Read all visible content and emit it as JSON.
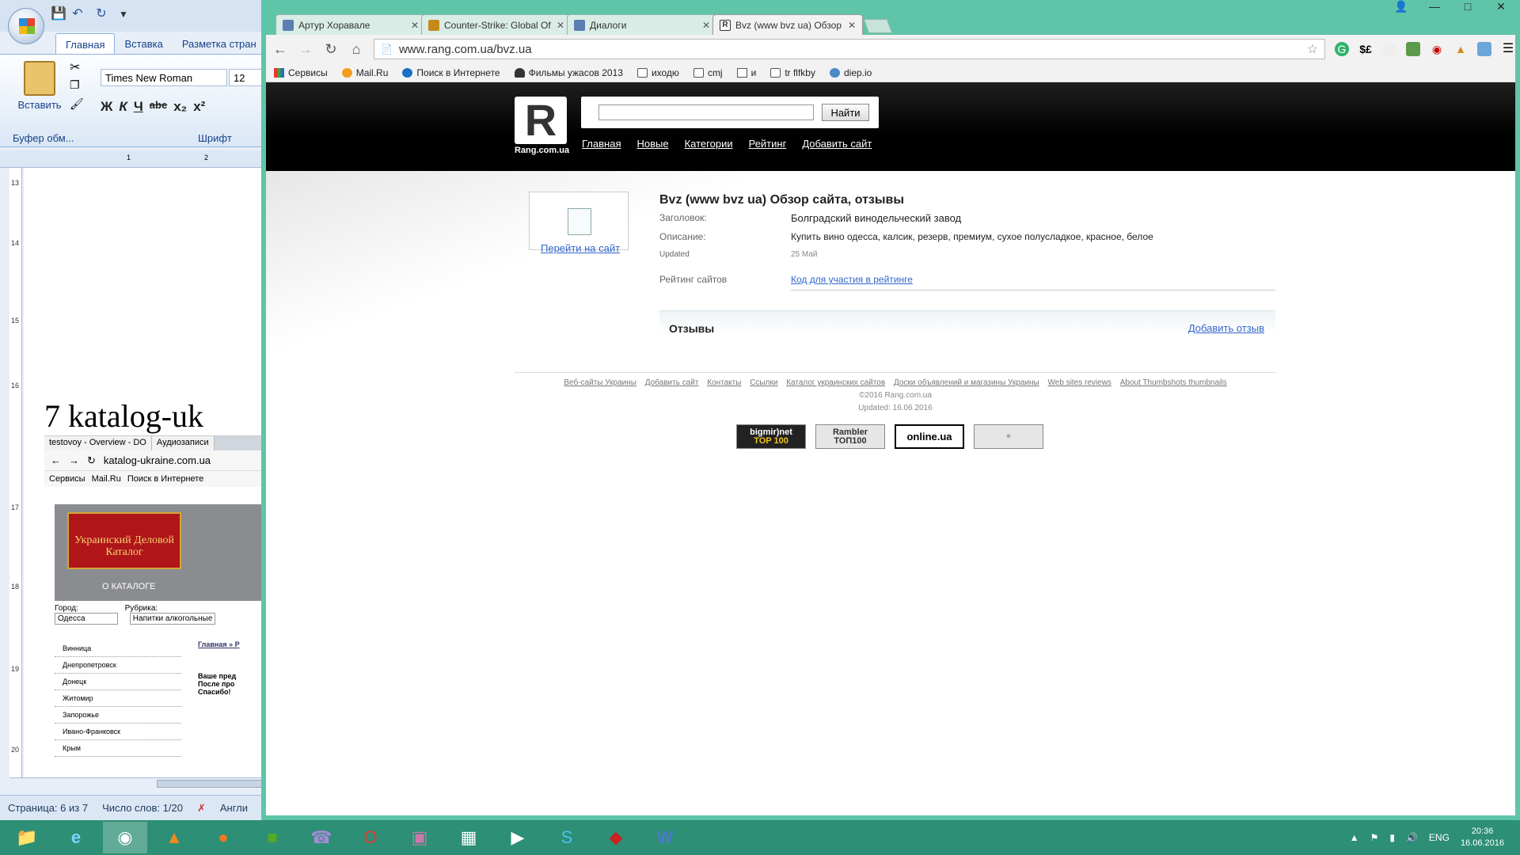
{
  "word": {
    "tabs": [
      "Главная",
      "Вставка",
      "Разметка стран"
    ],
    "paste_label": "Вставить",
    "font_name": "Times New Roman",
    "font_size": "12",
    "format_buttons": [
      "Ж",
      "К",
      "Ч",
      "abe",
      "x₂",
      "x²"
    ],
    "group_clipboard": "Буфер обм...",
    "group_font": "Шрифт",
    "ruler_numbers": [
      "1",
      "2"
    ],
    "vruler_numbers": [
      "13",
      "14",
      "15",
      "16",
      "17",
      "18",
      "19",
      "20"
    ],
    "doc_line": "7        katalog-uk",
    "embed": {
      "tabs": [
        "testovoy - Overview - DO",
        "Аудиозаписи"
      ],
      "address": "katalog-ukraine.com.ua",
      "bookmarks": [
        "Сервисы",
        "Mail.Ru",
        "Поиск в Интернете"
      ],
      "logo_text": "Украинский Деловой Каталог",
      "about": "О КАТАЛОГЕ",
      "city_label": "Город:",
      "city_value": "Одесса",
      "rubric_label": "Рубрика:",
      "rubric_value": "Напитки алкогольные",
      "breadcrumb": "Главная » Р",
      "cities": [
        "Винница",
        "Днепропетровск",
        "Донецк",
        "Житомир",
        "Запорожье",
        "Ивано-Франковск",
        "Крым"
      ],
      "notice": [
        "Ваше пред",
        "После про",
        "Спасибо!"
      ]
    },
    "status": {
      "page": "Страница: 6 из 7",
      "words": "Число слов: 1/20",
      "lang": "Англи"
    }
  },
  "chrome": {
    "tabs": [
      {
        "title": "Артур Хоравале",
        "color": "#5a7fb0"
      },
      {
        "title": "Counter-Strike: Global Of",
        "color": "#c68a1c"
      },
      {
        "title": "Диалоги",
        "color": "#5a7fb0"
      },
      {
        "title": "Bvz (www bvz ua) Обзор",
        "color": "#333333"
      }
    ],
    "url": "www.rang.com.ua/bvz.ua",
    "bookmarks": [
      "Сервисы",
      "Mail.Ru",
      "Поиск в Интернете",
      "Фильмы ужасов 2013",
      "иходю",
      "cmj",
      "и",
      "tr flfkby",
      "diep.io"
    ]
  },
  "site": {
    "logo_letter": "R",
    "logo_caption": "Rang.com.ua",
    "search_button": "Найти",
    "search_value": "",
    "nav": [
      "Главная",
      "Новые",
      "Категории",
      "Рейтинг",
      "Добавить сайт"
    ],
    "go_link": "Перейти на сайт",
    "title": "Bvz (www bvz ua) Обзор сайта, отзывы",
    "label_header": "Заголовок:",
    "value_header": "Болградский винодельческий завод",
    "label_desc": "Описание:",
    "value_desc": "Купить вино одесса, калсик, резерв, премиум, сухое полусладкое, красное, белое",
    "label_updated": "Updated",
    "value_updated": "25 Май",
    "label_rating": "Рейтинг сайтов",
    "rating_link": "Код для участия в рейтинге",
    "reviews_title": "Отзывы",
    "add_review": "Добавить отзыв",
    "footer_links": [
      "Веб-сайты Украины",
      "Добавить сайт",
      "Контакты",
      "Ссылки",
      "Каталог украинских сайтов",
      "Доски объявлений и магазины Украины",
      "Web sites reviews",
      "About Thumbshots thumbnails"
    ],
    "copyright": "©2016 Rang.com.ua",
    "footer_updated": "Updated: 16.06.2016",
    "counters": {
      "bigmir_top": "bigmir)net",
      "bigmir_sub": "TOP 100",
      "rambler": "Rambler ТОП100",
      "online": "online.ua"
    }
  },
  "taskbar": {
    "lang": "ENG",
    "time": "20:36",
    "date": "16.06.2016"
  }
}
